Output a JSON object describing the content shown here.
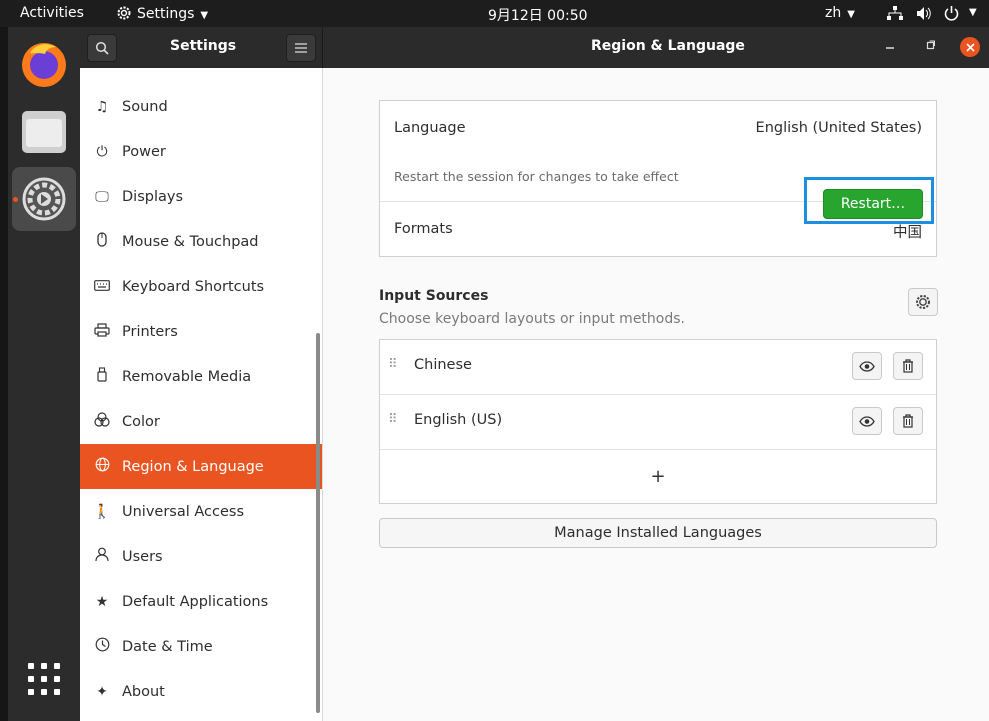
{
  "topbar": {
    "activities": "Activities",
    "app_menu": "Settings",
    "clock": "9月12日  00:50",
    "lang": "zh"
  },
  "sidebar_header": {
    "title": "Settings"
  },
  "main_header": {
    "title": "Region & Language"
  },
  "sidebar": {
    "items": [
      {
        "label": "Sound",
        "icon": "music-note-icon"
      },
      {
        "label": "Power",
        "icon": "power-icon"
      },
      {
        "label": "Displays",
        "icon": "display-icon"
      },
      {
        "label": "Mouse & Touchpad",
        "icon": "mouse-icon"
      },
      {
        "label": "Keyboard Shortcuts",
        "icon": "keyboard-icon"
      },
      {
        "label": "Printers",
        "icon": "printer-icon"
      },
      {
        "label": "Removable Media",
        "icon": "usb-drive-icon"
      },
      {
        "label": "Color",
        "icon": "color-icon"
      },
      {
        "label": "Region & Language",
        "icon": "globe-icon",
        "active": true
      },
      {
        "label": "Universal Access",
        "icon": "accessibility-icon"
      },
      {
        "label": "Users",
        "icon": "user-icon"
      },
      {
        "label": "Default Applications",
        "icon": "star-icon"
      },
      {
        "label": "Date & Time",
        "icon": "clock-icon"
      },
      {
        "label": "About",
        "icon": "sparkle-icon"
      }
    ]
  },
  "language": {
    "label": "Language",
    "value": "English (United States)",
    "restart_note": "Restart the session for changes to take effect",
    "restart_button": "Restart…"
  },
  "formats": {
    "label": "Formats",
    "value": "中国"
  },
  "input_sources": {
    "title": "Input Sources",
    "subtitle": "Choose keyboard layouts or input methods.",
    "items": [
      {
        "label": "Chinese"
      },
      {
        "label": "English (US)"
      }
    ],
    "add_symbol": "+"
  },
  "manage_button": "Manage Installed Languages",
  "colors": {
    "accent": "#e95420",
    "restart_green": "#27a52f",
    "highlight": "#1e8fe0"
  }
}
